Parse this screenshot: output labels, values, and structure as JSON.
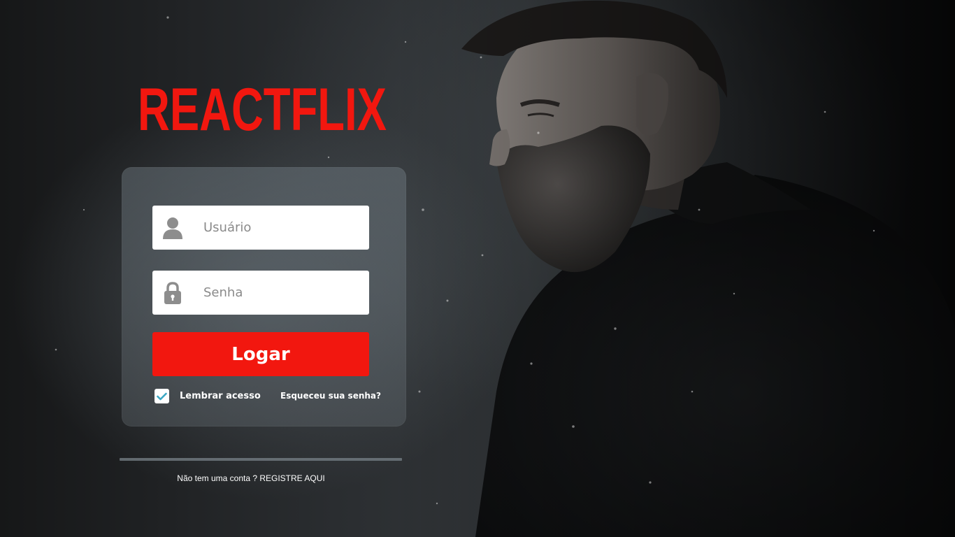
{
  "brand": {
    "logo_text": "REACTFLIX",
    "accent_color": "#f2170f"
  },
  "login_form": {
    "username": {
      "placeholder": "Usuário",
      "value": "",
      "icon": "user-icon"
    },
    "password": {
      "placeholder": "Senha",
      "value": "",
      "icon": "lock-icon"
    },
    "submit_label": "Logar",
    "remember": {
      "label": "Lembrar acesso",
      "checked": true,
      "check_color": "#3ba7c4"
    },
    "forgot_label": "Esqueceu sua senha?"
  },
  "footer": {
    "register_prompt": "Não tem uma conta ?",
    "register_link": "REGISTRE AQUI"
  }
}
